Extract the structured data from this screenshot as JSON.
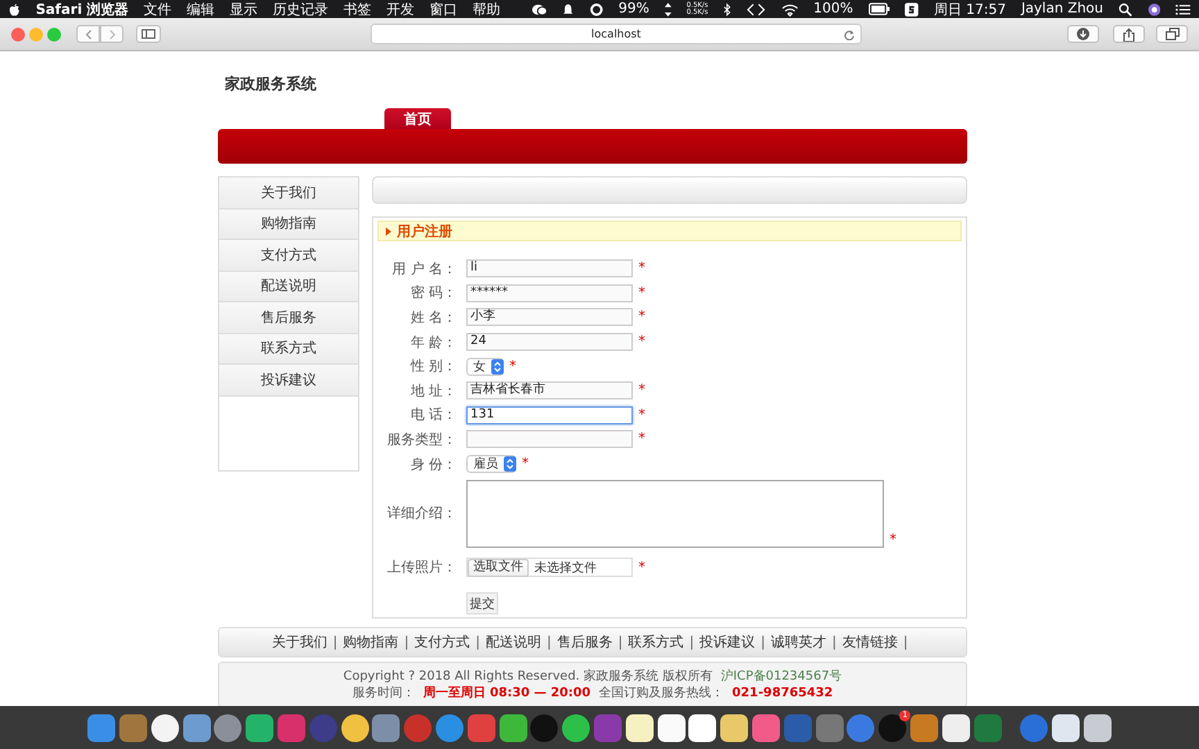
{
  "menubar": {
    "app": "Safari 浏览器",
    "menus": [
      "文件",
      "编辑",
      "显示",
      "历史记录",
      "书签",
      "开发",
      "窗口",
      "帮助"
    ],
    "status": {
      "cpu": "99%",
      "net_up": "0.5K/s",
      "net_down": "0.5K/s",
      "battery": "100%",
      "clock": "周日 17:57",
      "user": "Jaylan Zhou"
    }
  },
  "toolbar": {
    "address": "localhost"
  },
  "site": {
    "title": "家政服务系统",
    "tabs": [
      {
        "label": "首页",
        "selected": true
      }
    ],
    "sidebar": {
      "items": [
        "关于我们",
        "购物指南",
        "支付方式",
        "配送说明",
        "售后服务",
        "联系方式",
        "投诉建议"
      ]
    },
    "form": {
      "title": "用户注册",
      "fields": [
        {
          "kind": "text",
          "label": "用 户 名：",
          "value": "li",
          "mark": "*",
          "focused": false
        },
        {
          "kind": "text",
          "label": "密 码：",
          "value": "******",
          "mark": "*",
          "focused": false
        },
        {
          "kind": "text",
          "label": "姓 名：",
          "value": "小李",
          "mark": "*",
          "focused": false
        },
        {
          "kind": "text",
          "label": "年 龄：",
          "value": "24",
          "mark": "*",
          "focused": false
        },
        {
          "kind": "select",
          "label": "性 别：",
          "value": "女",
          "mark": "*",
          "focused": false
        },
        {
          "kind": "text",
          "label": "地 址：",
          "value": "吉林省长春市",
          "mark": "*",
          "focused": false
        },
        {
          "kind": "text",
          "label": "电 话：",
          "value": "131",
          "mark": "*",
          "focused": true
        },
        {
          "kind": "text",
          "label": "服务类型：",
          "mark": "*",
          "focused": false
        },
        {
          "kind": "select",
          "label": "身 份：",
          "value": "雇员",
          "mark": "*",
          "focused": false
        },
        {
          "kind": "textarea",
          "label": "详细介绍：",
          "mark": "*",
          "focused": false
        },
        {
          "kind": "file",
          "label": "上传照片：",
          "button": "选取文件",
          "value": "未选择文件",
          "mark": "*",
          "focused": false
        }
      ],
      "submit": "提交"
    },
    "footer": {
      "links": [
        {
          "label": "关于我们",
          "separator": "|"
        },
        {
          "label": "购物指南",
          "separator": "|"
        },
        {
          "label": "支付方式",
          "separator": "|"
        },
        {
          "label": "配送说明",
          "separator": "|"
        },
        {
          "label": "售后服务",
          "separator": "|"
        },
        {
          "label": "联系方式",
          "separator": "|"
        },
        {
          "label": "投诉建议",
          "separator": "|"
        },
        {
          "label": "诚聘英才",
          "separator": "|"
        },
        {
          "label": "友情链接",
          "separator": "|"
        }
      ],
      "copyright": "Copyright ? 2018 All Rights Reserved. 家政服务系统 版权所有",
      "icp": "沪ICP备01234567号",
      "hours_label": "服务时间：",
      "hours": "周一至周日 08:30 — 20:00",
      "hotline_label": "全国订购及服务热线：",
      "hotline": "021-98765432"
    }
  },
  "dock": {
    "badge": "1"
  }
}
